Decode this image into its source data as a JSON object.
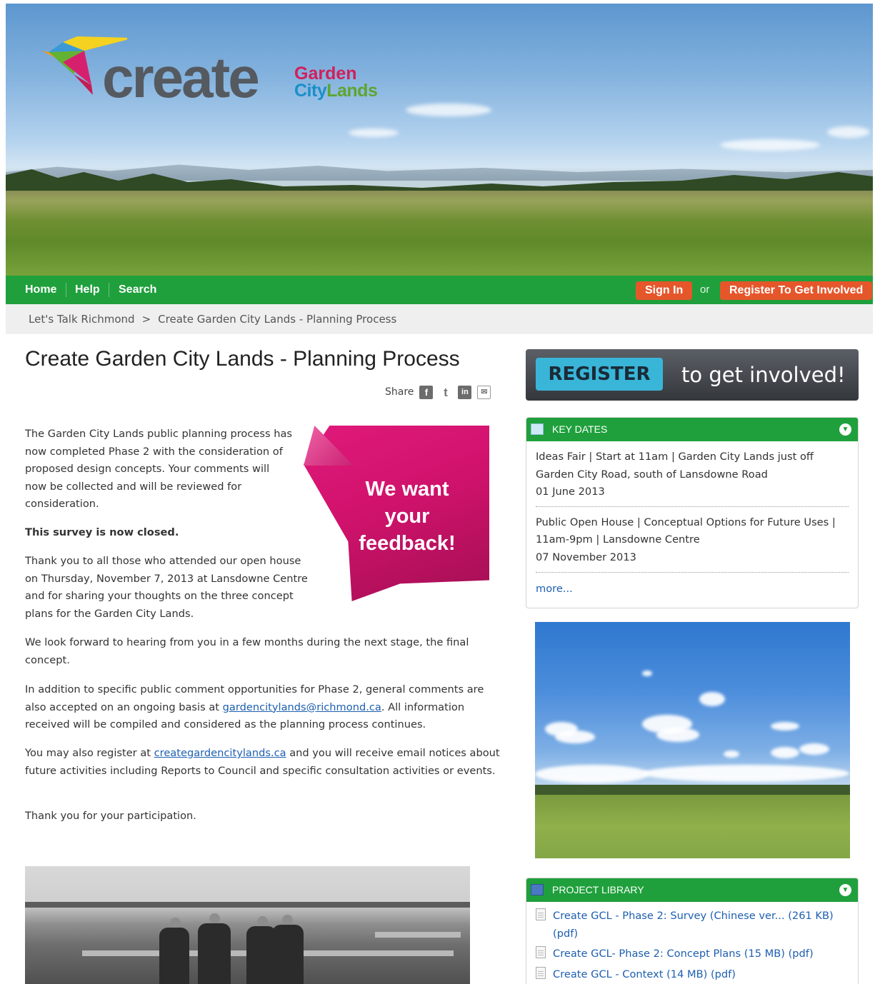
{
  "logo": {
    "word": "create",
    "garden": "Garden",
    "city_a": "City",
    "city_b": "Lands"
  },
  "nav": {
    "home": "Home",
    "help": "Help",
    "search": "Search",
    "sign_in": "Sign In",
    "or": "or",
    "register": "Register To Get Involved"
  },
  "breadcrumb": {
    "root": "Let's Talk Richmond",
    "separator": ">",
    "current": "Create Garden City Lands - Planning Process"
  },
  "page": {
    "title": "Create Garden City Lands - Planning Process",
    "share_label": "Share",
    "intro": "The Garden City Lands public planning process has now completed Phase 2 with the consideration of proposed design concepts. Your comments will now be collected and will be reviewed for consideration.",
    "survey_closed": "This survey is now closed.",
    "thanks_open_house": "Thank you to all those who attended our open house on Thursday, November 7, 2013 at Lansdowne Centre and for sharing your thoughts on the three concept plans for the Garden City Lands.",
    "look_forward": "We look forward to hearing from you in a few months during the next stage, the final concept.",
    "comments_a": "In addition to specific public comment opportunities for Phase 2, general comments are also accepted on an ongoing basis at ",
    "comments_email": "gardencitylands@richmond.ca",
    "comments_b": ". All information received will be compiled and considered as the planning process continues.",
    "register_a": "You may also register at ",
    "register_link": "creategardencitylands.ca",
    "register_b": " and you will receive email notices about future activities including Reports to Council and specific consultation activities or events.",
    "thank_you": "Thank you for your participation.",
    "feedback_banner": "We want your feedback!"
  },
  "sidebar": {
    "register_button": "REGISTER",
    "register_tail": "to get involved!",
    "key_dates": {
      "title": "KEY DATES",
      "events": [
        {
          "text": "Ideas Fair | Start at 11am | Garden City Lands just off Garden City Road, south of Lansdowne Road",
          "date": "01 June 2013"
        },
        {
          "text": "Public Open House | Conceptual Options for Future Uses | 11am-9pm | Lansdowne Centre",
          "date": "07 November 2013"
        }
      ],
      "more": "more..."
    },
    "library": {
      "title": "PROJECT LIBRARY",
      "items": [
        "Create GCL - Phase 2: Survey (Chinese ver... (261 KB) (pdf)",
        "Create GCL- Phase 2: Concept Plans (15 MB) (pdf)",
        "Create GCL - Context (14 MB) (pdf)"
      ]
    }
  },
  "icons": {
    "facebook": "facebook-icon",
    "twitter": "twitter-icon",
    "linkedin": "linkedin-icon",
    "email": "email-icon",
    "calendar": "calendar-icon",
    "book": "book-icon",
    "toggle": "chevron-down-icon",
    "document": "document-icon"
  },
  "colors": {
    "nav_green": "#1fa03c",
    "button_orange": "#e5562b",
    "link_blue": "#1d5fb0",
    "register_cyan": "#39b5d8",
    "feedback_pink": "#d0126c"
  }
}
